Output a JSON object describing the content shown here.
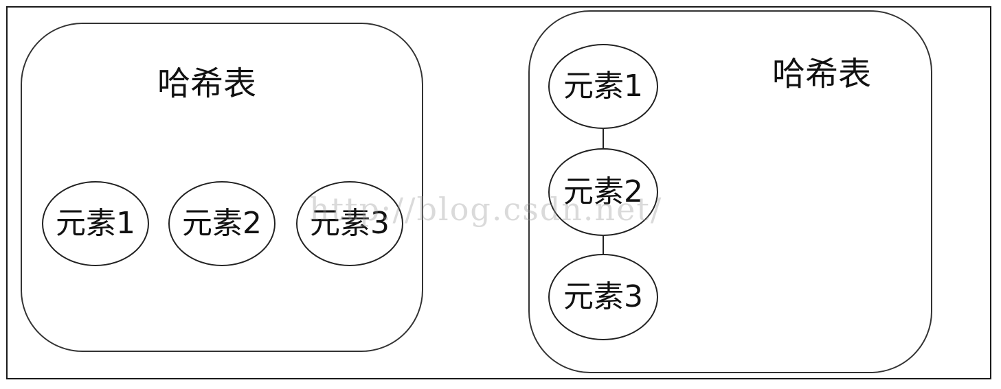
{
  "left_panel": {
    "title": "哈希表",
    "elements": [
      "元素1",
      "元素2",
      "元素3"
    ]
  },
  "right_panel": {
    "title": "哈希表",
    "elements": [
      "元素1",
      "元素2",
      "元素3"
    ]
  },
  "watermark": "http://blog.csdn.net/"
}
